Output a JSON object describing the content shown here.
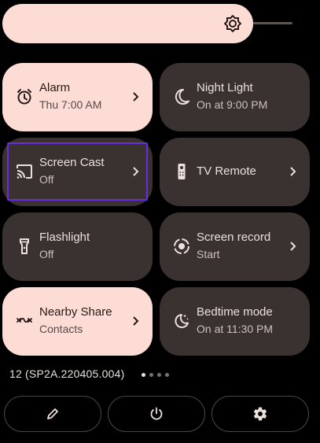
{
  "brightness": {
    "icon": "brightness-icon",
    "level": 0.79
  },
  "tiles": [
    {
      "label": "Alarm",
      "sub": "Thu 7:00 AM",
      "state": "on",
      "icon": "alarm-icon"
    },
    {
      "label": "Night Light",
      "sub": "On at 9:00 PM",
      "state": "off",
      "icon": "night-light-icon"
    },
    {
      "label": "Screen Cast",
      "sub": "Off",
      "state": "off",
      "icon": "cast-icon",
      "focused": true
    },
    {
      "label": "TV Remote",
      "sub": "",
      "state": "off",
      "icon": "tv-remote-icon"
    },
    {
      "label": "Flashlight",
      "sub": "Off",
      "state": "off",
      "icon": "flashlight-icon"
    },
    {
      "label": "Screen record",
      "sub": "Start",
      "state": "off",
      "icon": "screen-record-icon"
    },
    {
      "label": "Nearby Share",
      "sub": "Contacts",
      "state": "on",
      "icon": "nearby-share-icon"
    },
    {
      "label": "Bedtime mode",
      "sub": "On at 11:30 PM",
      "state": "off",
      "icon": "bedtime-icon"
    }
  ],
  "build_number": "12 (SP2A.220405.004)",
  "page_dots": {
    "count": 4,
    "active_index": 0
  },
  "footer": [
    {
      "icon": "edit-icon"
    },
    {
      "icon": "power-icon"
    },
    {
      "icon": "settings-icon"
    }
  ],
  "colors": {
    "tile_on": "#fddcd6",
    "tile_off": "#3a3230",
    "focus": "#6a2ce0",
    "background": "#000000"
  }
}
